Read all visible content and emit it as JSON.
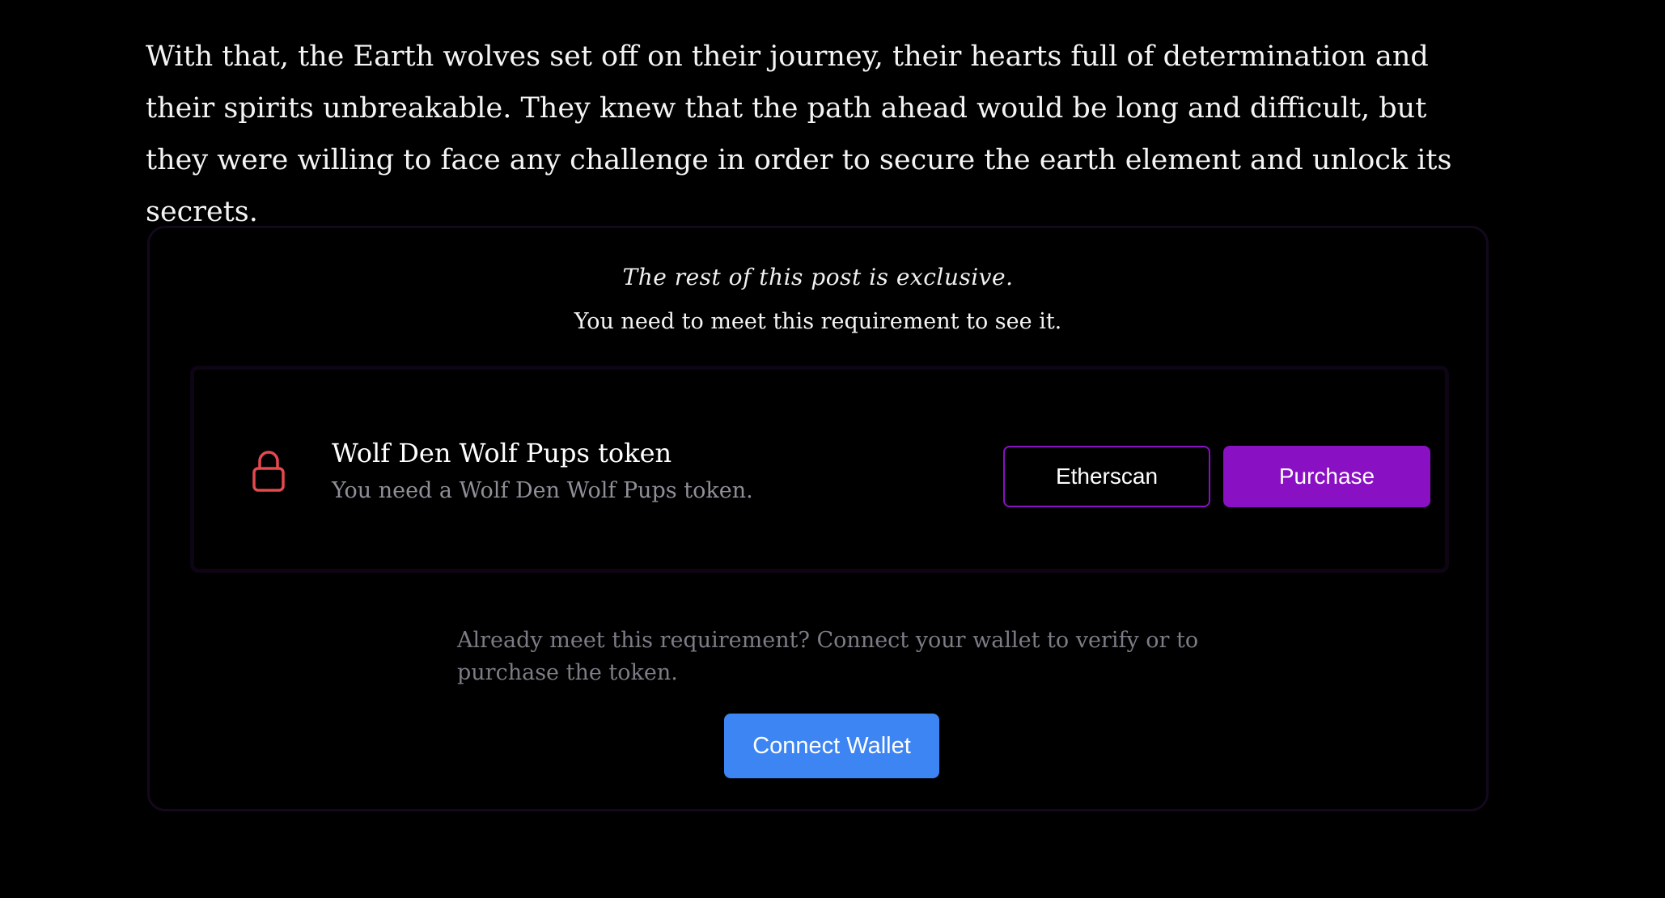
{
  "article": {
    "paragraph": "With that, the Earth wolves set off on their journey, their hearts full of determination and their spirits unbreakable. They knew that the path ahead would be long and difficult, but they were willing to face any challenge in order to secure the earth element and unlock its secrets."
  },
  "gate": {
    "heading": "The rest of this post is exclusive.",
    "subheading": "You need to meet this requirement to see it.",
    "requirement": {
      "icon": "lock-icon",
      "title": "Wolf Den Wolf Pups token",
      "description": "You need a Wolf Den Wolf Pups token.",
      "etherscan_label": "Etherscan",
      "purchase_label": "Purchase"
    },
    "wallet_note": "Already meet this requirement? Connect your wallet to verify or to purchase the token.",
    "connect_label": "Connect Wallet"
  },
  "colors": {
    "background": "#000000",
    "accent_purple": "#8a10c4",
    "connect_blue": "#3d85f2",
    "lock_red": "#e5484d",
    "muted_text": "#7c7c86"
  }
}
